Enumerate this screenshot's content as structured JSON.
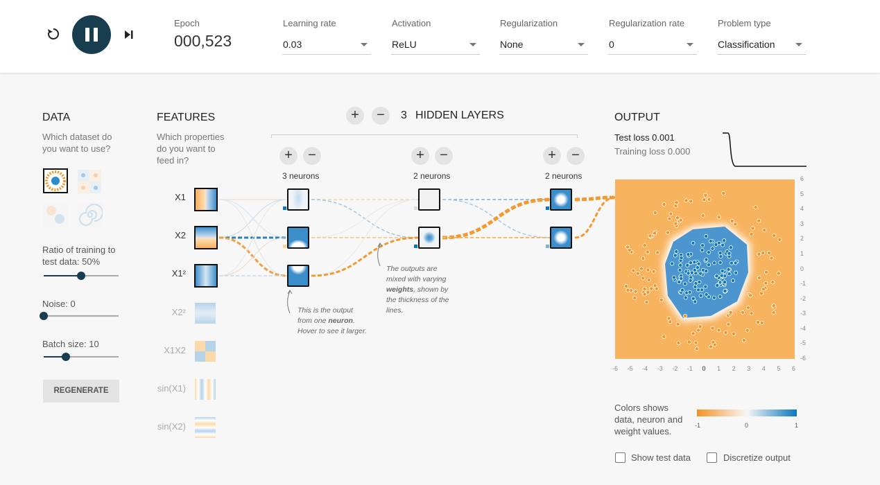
{
  "controls": {
    "reset_icon": "reset-icon",
    "play_icon": "pause-icon",
    "step_icon": "step-icon"
  },
  "epoch": {
    "label": "Epoch",
    "value": "000,523"
  },
  "dropdowns": [
    {
      "label": "Learning rate",
      "value": "0.03"
    },
    {
      "label": "Activation",
      "value": "ReLU"
    },
    {
      "label": "Regularization",
      "value": "None"
    },
    {
      "label": "Regularization rate",
      "value": "0"
    },
    {
      "label": "Problem type",
      "value": "Classification"
    }
  ],
  "data_panel": {
    "title": "DATA",
    "subtitle": "Which dataset do you want to use?",
    "ratio_label": "Ratio of training to test data:",
    "ratio_value": "50%",
    "ratio_level": 0.5,
    "noise_label": "Noise:",
    "noise_value": "0",
    "noise_level": 0,
    "batch_label": "Batch size:",
    "batch_value": "10",
    "batch_level": 0.3,
    "regenerate": "REGENERATE"
  },
  "features_panel": {
    "title": "FEATURES",
    "subtitle": "Which properties do you want to feed in?",
    "features": [
      {
        "label": "X1",
        "active": true
      },
      {
        "label": "X2",
        "active": true
      },
      {
        "label": "X1²",
        "active": true
      },
      {
        "label": "X2²",
        "active": false
      },
      {
        "label": "X1X2",
        "active": false
      },
      {
        "label": "sin(X1)",
        "active": false
      },
      {
        "label": "sin(X2)",
        "active": false
      }
    ]
  },
  "network": {
    "layer_count": "3",
    "layers_label": "HIDDEN LAYERS",
    "layers": [
      {
        "neurons_label": "3 neurons"
      },
      {
        "neurons_label": "2 neurons"
      },
      {
        "neurons_label": "2 neurons"
      }
    ],
    "note_neuron_pre": "This is the output from one ",
    "note_neuron_bold": "neuron",
    "note_neuron_post": ". Hover to see it larger.",
    "note_weights_pre": "The outputs are mixed with varying ",
    "note_weights_bold": "weights",
    "note_weights_post": ", shown by the thickness of the lines."
  },
  "output": {
    "title": "OUTPUT",
    "test_loss": "Test loss 0.001",
    "training_loss": "Training loss 0.000",
    "y_ticks": [
      "6",
      "5",
      "4",
      "3",
      "2",
      "1",
      "0",
      "-1",
      "-2",
      "-3",
      "-4",
      "-5",
      "-6"
    ],
    "x_ticks": [
      "-6",
      "-5",
      "-4",
      "-3",
      "-2",
      "-1",
      "0",
      "1",
      "2",
      "3",
      "4",
      "5",
      "6"
    ],
    "legend_text": "Colors shows data, neuron and weight values.",
    "legend_ticks": [
      "-1",
      "0",
      "1"
    ],
    "show_test_data": "Show test data",
    "discretize_output": "Discretize output"
  },
  "colors": {
    "orange": "#f59322",
    "blue": "#0877bd",
    "dark": "#183d4e",
    "bg": "#f7f7f7"
  }
}
